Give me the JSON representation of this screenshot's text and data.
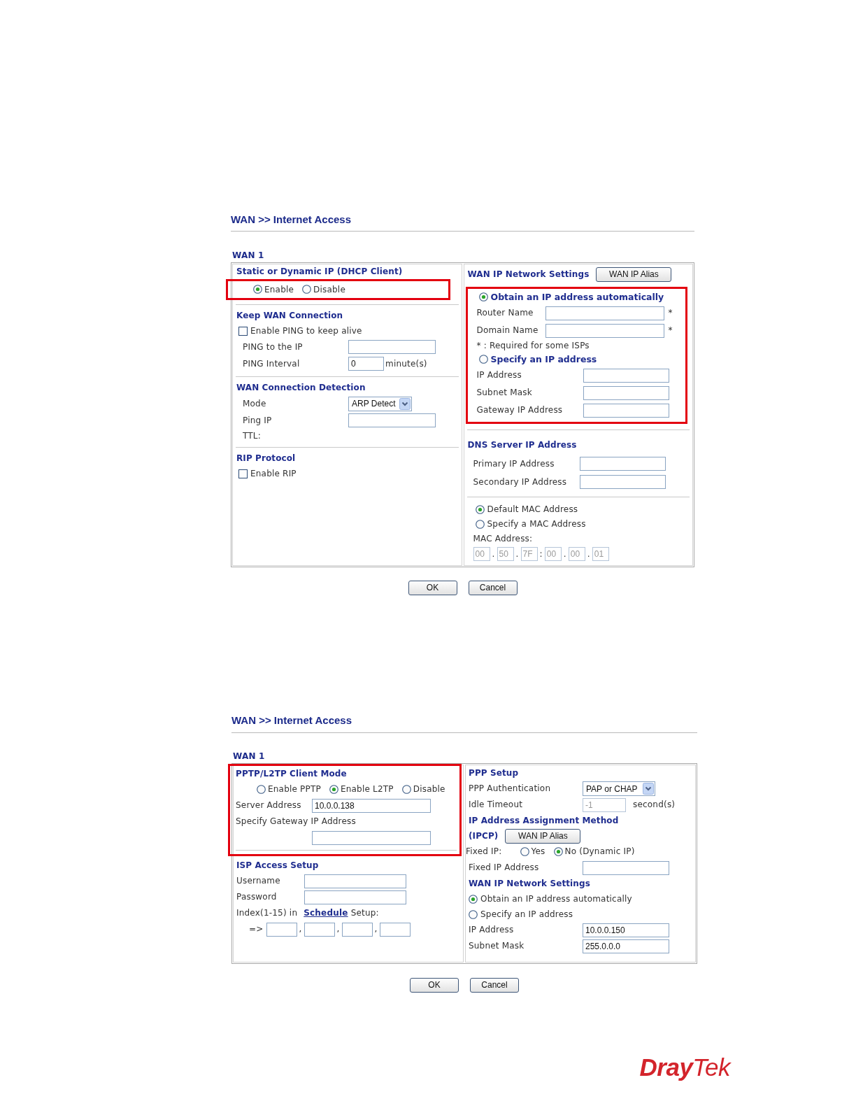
{
  "pages": [
    {
      "breadcrumb": "WAN >> Internet Access",
      "wan": "WAN 1",
      "columns": [
        {
          "blocks": [
            {
              "kind": "plain",
              "rows": [
                {
                  "kind": "heading",
                  "text": "Static or Dynamic IP (DHCP Client)"
                }
              ]
            },
            {
              "kind": "highlight",
              "rows": [
                {
                  "kind": "radio_group",
                  "options": [
                    {
                      "label": "Enable",
                      "selected": true
                    },
                    {
                      "label": "Disable",
                      "selected": false
                    }
                  ]
                }
              ]
            },
            {
              "kind": "plain",
              "rows": [
                {
                  "kind": "divider"
                },
                {
                  "kind": "heading",
                  "text": "Keep WAN Connection"
                },
                {
                  "kind": "checkbox",
                  "label": "Enable PING to keep alive",
                  "checked": false
                },
                {
                  "kind": "field",
                  "label": "PING to the IP",
                  "disabled": false
                },
                {
                  "kind": "field",
                  "label": "PING Interval",
                  "value": "0",
                  "suffix": "minute(s)",
                  "disabled": false
                },
                {
                  "kind": "divider"
                },
                {
                  "kind": "heading",
                  "text": "WAN Connection Detection"
                },
                {
                  "kind": "select",
                  "label": "Mode",
                  "value": "ARP Detect"
                },
                {
                  "kind": "field",
                  "label": "Ping IP",
                  "disabled": false
                },
                {
                  "kind": "text",
                  "text": "TTL:"
                },
                {
                  "kind": "divider"
                },
                {
                  "kind": "heading",
                  "text": "RIP Protocol"
                },
                {
                  "kind": "checkbox",
                  "label": "Enable RIP",
                  "checked": false
                }
              ]
            }
          ]
        },
        {
          "blocks": [
            {
              "kind": "plain",
              "rows": [
                {
                  "kind": "heading",
                  "text": "WAN IP Network Settings",
                  "button": "WAN IP Alias"
                }
              ]
            },
            {
              "kind": "highlight",
              "rows": [
                {
                  "kind": "radio_heading",
                  "label": "Obtain an IP address automatically",
                  "selected": true
                },
                {
                  "kind": "field",
                  "label": "Router Name",
                  "note": "*",
                  "disabled": false
                },
                {
                  "kind": "field",
                  "label": "Domain Name",
                  "note": "*",
                  "disabled": false
                },
                {
                  "kind": "text",
                  "text": "* : Required for some ISPs"
                },
                {
                  "kind": "radio_heading",
                  "label": "Specify an IP address",
                  "selected": false
                },
                {
                  "kind": "field",
                  "label": "IP Address",
                  "disabled": false
                },
                {
                  "kind": "field",
                  "label": "Subnet Mask",
                  "disabled": false
                },
                {
                  "kind": "field",
                  "label": "Gateway IP Address",
                  "disabled": false
                }
              ]
            },
            {
              "kind": "plain",
              "rows": [
                {
                  "kind": "divider"
                },
                {
                  "kind": "heading",
                  "text": "DNS Server IP Address"
                },
                {
                  "kind": "field",
                  "label": "Primary IP Address",
                  "disabled": false
                },
                {
                  "kind": "field",
                  "label": "Secondary IP Address",
                  "disabled": false
                },
                {
                  "kind": "divider"
                },
                {
                  "kind": "radio",
                  "label": "Default MAC Address",
                  "selected": true
                },
                {
                  "kind": "radio",
                  "label": "Specify a MAC Address",
                  "selected": false
                },
                {
                  "kind": "text",
                  "text": "MAC Address:"
                },
                {
                  "kind": "mac",
                  "disabled": true,
                  "octets": [
                    "00",
                    "50",
                    "7F",
                    "00",
                    "00",
                    "01"
                  ],
                  "separators": [
                    ".",
                    ".",
                    ":",
                    ".",
                    "."
                  ]
                }
              ]
            }
          ]
        }
      ],
      "buttons": [
        "OK",
        "Cancel"
      ]
    },
    {
      "breadcrumb": "WAN >> Internet Access",
      "wan": "WAN 1",
      "columns": [
        {
          "blocks": [
            {
              "kind": "highlight",
              "rows": [
                {
                  "kind": "heading",
                  "text": "PPTP/L2TP Client Mode"
                },
                {
                  "kind": "radio_group",
                  "options": [
                    {
                      "label": "Enable PPTP",
                      "selected": false
                    },
                    {
                      "label": "Enable L2TP",
                      "selected": true
                    },
                    {
                      "label": "Disable",
                      "selected": false
                    }
                  ]
                },
                {
                  "kind": "field",
                  "label": "Server Address",
                  "value": "10.0.0.138",
                  "disabled": false
                },
                {
                  "kind": "text",
                  "text": "Specify Gateway IP Address"
                },
                {
                  "kind": "field",
                  "disabled": false
                },
                {
                  "kind": "divider"
                }
              ]
            },
            {
              "kind": "plain",
              "rows": [
                {
                  "kind": "heading",
                  "text": "ISP Access Setup"
                },
                {
                  "kind": "field",
                  "label": "Username",
                  "disabled": false
                },
                {
                  "kind": "field",
                  "label": "Password",
                  "disabled": false
                },
                {
                  "kind": "link_text",
                  "before": "Index(1-15) in",
                  "link": "Schedule",
                  "after": "Setup:"
                },
                {
                  "kind": "index_fields",
                  "prefix": "=>",
                  "separators": [
                    ",",
                    ",",
                    ","
                  ]
                }
              ]
            }
          ]
        },
        {
          "blocks": [
            {
              "kind": "plain",
              "rows": [
                {
                  "kind": "heading",
                  "text": "PPP Setup"
                },
                {
                  "kind": "select",
                  "label": "PPP Authentication",
                  "value": "PAP or CHAP"
                },
                {
                  "kind": "field",
                  "label": "Idle Timeout",
                  "value": "-1",
                  "suffix": "second(s)",
                  "disabled": true
                },
                {
                  "kind": "heading",
                  "text": "IP Address Assignment Method"
                },
                {
                  "kind": "heading",
                  "text": "(IPCP)",
                  "button": "WAN IP Alias"
                },
                {
                  "kind": "radio_group",
                  "label": "Fixed IP:",
                  "options": [
                    {
                      "label": "Yes",
                      "selected": false
                    },
                    {
                      "label": "No (Dynamic IP)",
                      "selected": true
                    }
                  ]
                },
                {
                  "kind": "field",
                  "label": "Fixed IP Address",
                  "disabled": false
                },
                {
                  "kind": "heading",
                  "text": "WAN IP Network Settings"
                },
                {
                  "kind": "radio",
                  "label": "Obtain an IP address automatically",
                  "selected": true
                },
                {
                  "kind": "radio",
                  "label": "Specify an IP address",
                  "selected": false
                },
                {
                  "kind": "field",
                  "label": "IP Address",
                  "value": "10.0.0.150",
                  "disabled": false
                },
                {
                  "kind": "field",
                  "label": "Subnet Mask",
                  "value": "255.0.0.0",
                  "disabled": false
                }
              ]
            }
          ]
        }
      ],
      "buttons": [
        "OK",
        "Cancel"
      ]
    }
  ],
  "logo": "**Dray**Tek"
}
